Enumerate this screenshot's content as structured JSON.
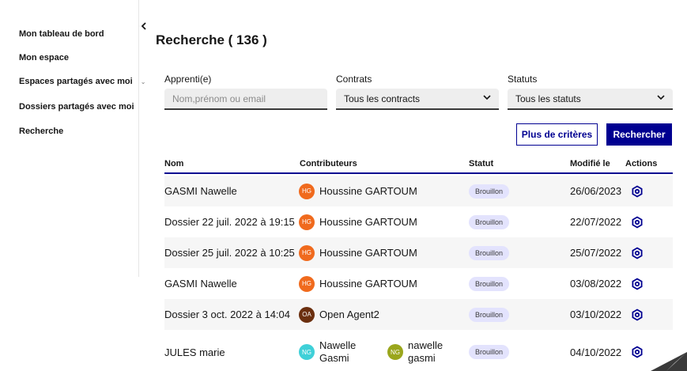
{
  "sidebar": {
    "collapse_icon": "chevron-left-icon",
    "items": [
      {
        "label": "Mon tableau de bord"
      },
      {
        "label": "Mon espace"
      },
      {
        "label": "Espaces partagés avec moi",
        "chevron": "⌄"
      },
      {
        "label": "Dossiers partagés avec moi"
      },
      {
        "label": "Recherche"
      }
    ]
  },
  "page": {
    "title": "Recherche ( 136 )"
  },
  "filters": {
    "apprenti": {
      "label": "Apprenti(e)",
      "placeholder": "Nom,prénom ou email"
    },
    "contrats": {
      "label": "Contrats",
      "value": "Tous les contracts"
    },
    "statuts": {
      "label": "Statuts",
      "value": "Tous les statuts"
    }
  },
  "buttons": {
    "more_criteria": "Plus de critères",
    "search": "Rechercher"
  },
  "table": {
    "headers": {
      "nom": "Nom",
      "contributeurs": "Contributeurs",
      "statut": "Statut",
      "modifie": "Modifié le",
      "actions": "Actions"
    },
    "rows": [
      {
        "nom": "GASMI Nawelle",
        "contributors": [
          {
            "initials": "HG",
            "name": "Houssine GARTOUM",
            "color": "#f06a1d"
          }
        ],
        "statut": "Brouillon",
        "modifie": "26/06/2023"
      },
      {
        "nom": "Dossier 22 juil. 2022 à 19:15",
        "contributors": [
          {
            "initials": "HG",
            "name": "Houssine GARTOUM",
            "color": "#f06a1d"
          }
        ],
        "statut": "Brouillon",
        "modifie": "22/07/2022"
      },
      {
        "nom": "Dossier 25 juil. 2022 à 10:25",
        "contributors": [
          {
            "initials": "HG",
            "name": "Houssine GARTOUM",
            "color": "#f06a1d"
          }
        ],
        "statut": "Brouillon",
        "modifie": "25/07/2022"
      },
      {
        "nom": "GASMI Nawelle",
        "contributors": [
          {
            "initials": "HG",
            "name": "Houssine GARTOUM",
            "color": "#f06a1d"
          }
        ],
        "statut": "Brouillon",
        "modifie": "03/08/2022"
      },
      {
        "nom": "Dossier 3 oct. 2022 à 14:04",
        "contributors": [
          {
            "initials": "OA",
            "name": "Open Agent2",
            "color": "#6b2f0f"
          }
        ],
        "statut": "Brouillon",
        "modifie": "03/10/2022"
      },
      {
        "nom": "JULES marie",
        "contributors": [
          {
            "initials": "NG",
            "name": "Nawelle Gasmi",
            "color": "#3fd0d8"
          },
          {
            "initials": "NG",
            "name": "nawelle gasmi",
            "color": "#9aa61c"
          }
        ],
        "statut": "Brouillon",
        "modifie": "04/10/2022"
      }
    ]
  },
  "colors": {
    "primary": "#000091",
    "badge_bg": "#e3e3fd"
  }
}
